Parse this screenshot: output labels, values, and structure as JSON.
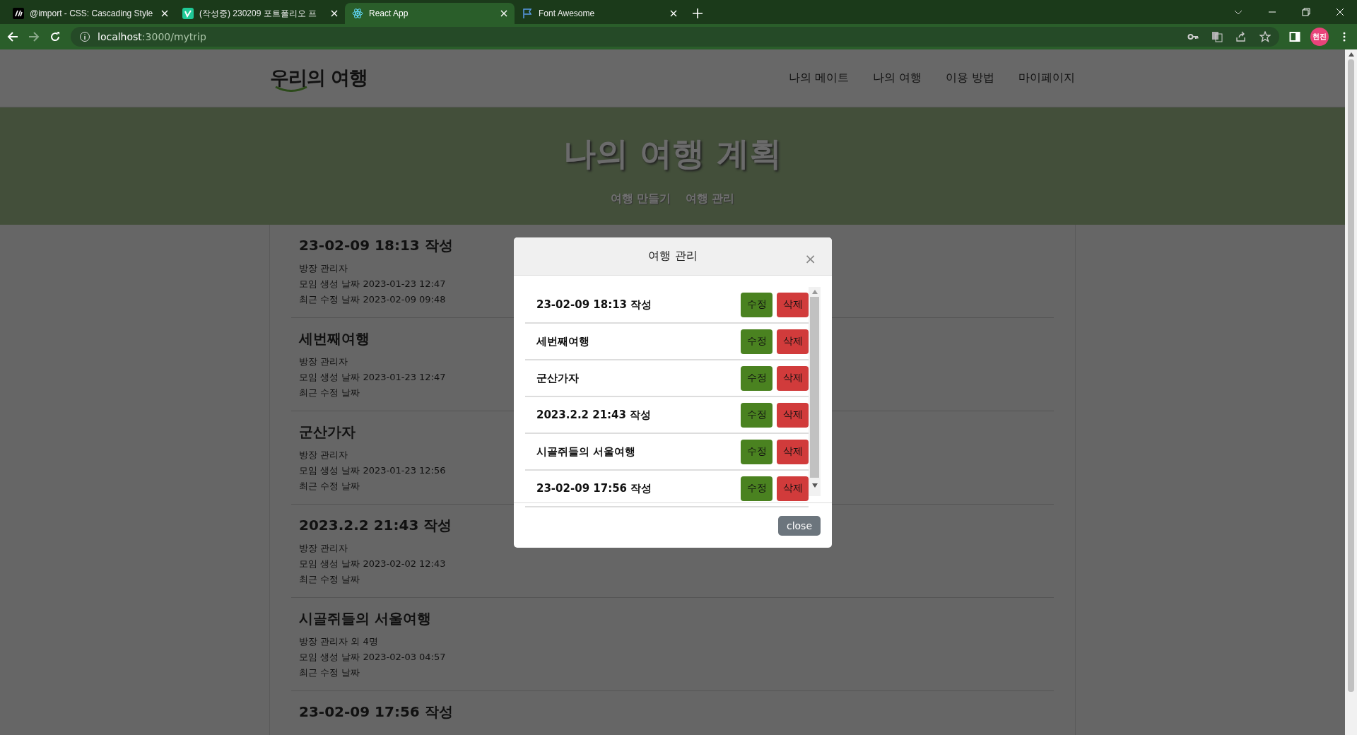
{
  "browser": {
    "tabs": [
      {
        "title": "@import - CSS: Cascading Style",
        "kind": "mdn",
        "selected": false
      },
      {
        "title": "(작성중) 230209 포트폴리오 프",
        "kind": "velog",
        "selected": false
      },
      {
        "title": "React App",
        "kind": "react",
        "selected": true
      },
      {
        "title": "Font Awesome",
        "kind": "flag",
        "selected": false
      }
    ],
    "url_host": "localhost",
    "url_path": ":3000/mytrip",
    "profile": "현진"
  },
  "nav": {
    "logo": "우리의 여행",
    "links": [
      "나의 메이트",
      "나의 여행",
      "이용 방법",
      "마이페이지"
    ]
  },
  "hero": {
    "title": "나의 여행 계획",
    "links": [
      "여행 만들기",
      "여행 관리"
    ]
  },
  "trips": [
    {
      "title": "23-02-09 18:13 작성",
      "owner": "방장 관리자",
      "created": "모임 생성 날짜 2023-01-23 12:47",
      "updated": "최근 수정 날짜 2023-02-09 09:48"
    },
    {
      "title": "세번째여행",
      "owner": "방장 관리자",
      "created": "모임 생성 날짜 2023-01-23 12:47",
      "updated": "최근 수정 날짜"
    },
    {
      "title": "군산가자",
      "owner": "방장 관리자",
      "created": "모임 생성 날짜 2023-01-23 12:56",
      "updated": "최근 수정 날짜"
    },
    {
      "title": "2023.2.2 21:43 작성",
      "owner": "방장 관리자",
      "created": "모임 생성 날짜 2023-02-02 12:43",
      "updated": "최근 수정 날짜"
    },
    {
      "title": "시골쥐들의 서울여행",
      "owner": "방장 관리자 외 4명",
      "created": "모임 생성 날짜 2023-02-03 04:57",
      "updated": "최근 수정 날짜"
    },
    {
      "title": "23-02-09 17:56 작성"
    }
  ],
  "modal": {
    "title": "여행 관리",
    "close_icon": "×",
    "close_button": "close",
    "items": [
      {
        "title": "23-02-09 18:13 작성",
        "edit": "수정",
        "delete": "삭제"
      },
      {
        "title": "세번째여행",
        "edit": "수정",
        "delete": "삭제"
      },
      {
        "title": "군산가자",
        "edit": "수정",
        "delete": "삭제"
      },
      {
        "title": "2023.2.2 21:43 작성",
        "edit": "수정",
        "delete": "삭제"
      },
      {
        "title": "시골쥐들의 서울여행",
        "edit": "수정",
        "delete": "삭제"
      },
      {
        "title": "23-02-09 17:56 작성",
        "edit": "수정",
        "delete": "삭제"
      }
    ]
  }
}
